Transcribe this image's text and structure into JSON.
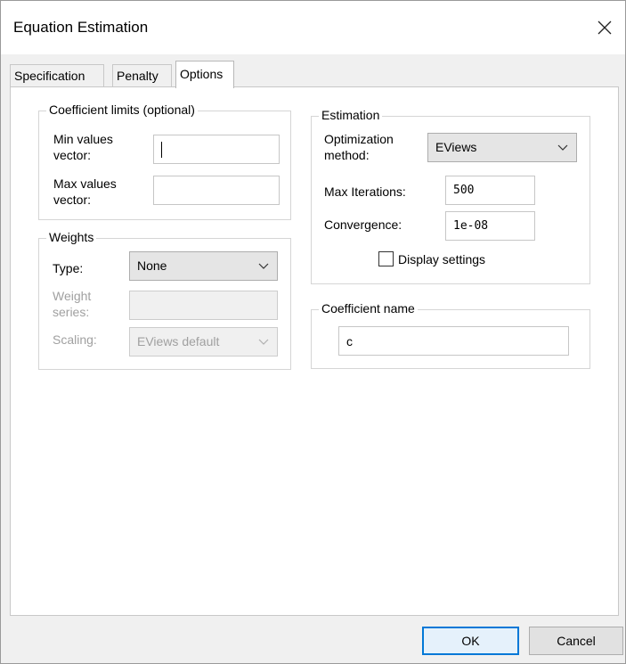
{
  "window": {
    "title": "Equation Estimation",
    "close_symbol": "✕"
  },
  "tabs": [
    {
      "label": "Specification"
    },
    {
      "label": "Penalty"
    },
    {
      "label": "Options",
      "active": true
    }
  ],
  "coefficient_limits": {
    "group_label": "Coefficient limits (optional)",
    "min_label_1": "Min values",
    "min_label_2": "vector:",
    "min_value": "",
    "max_label_1": "Max values",
    "max_label_2": "vector:",
    "max_value": ""
  },
  "weights": {
    "group_label": "Weights",
    "type_label": "Type:",
    "type_value": "None",
    "weight_series_label_1": "Weight",
    "weight_series_label_2": "series:",
    "weight_series_value": "",
    "scaling_label": "Scaling:",
    "scaling_value": "EViews default"
  },
  "estimation": {
    "group_label": "Estimation",
    "optimization_label_1": "Optimization",
    "optimization_label_2": "method:",
    "optimization_value": "EViews",
    "max_iterations_label": "Max Iterations:",
    "max_iterations_value": "500",
    "convergence_label": "Convergence:",
    "convergence_value": "1e-08",
    "display_settings_label": "Display settings",
    "display_settings_checked": false
  },
  "coefficient_name": {
    "group_label": "Coefficient name",
    "value": "c"
  },
  "buttons": {
    "ok_label": "OK",
    "cancel_label": "Cancel"
  },
  "colors": {
    "dialog_bg": "#f0f0f0",
    "panel_bg": "#ffffff",
    "default_button_border": "#0078d7",
    "disabled_text": "#a0a0a0"
  }
}
